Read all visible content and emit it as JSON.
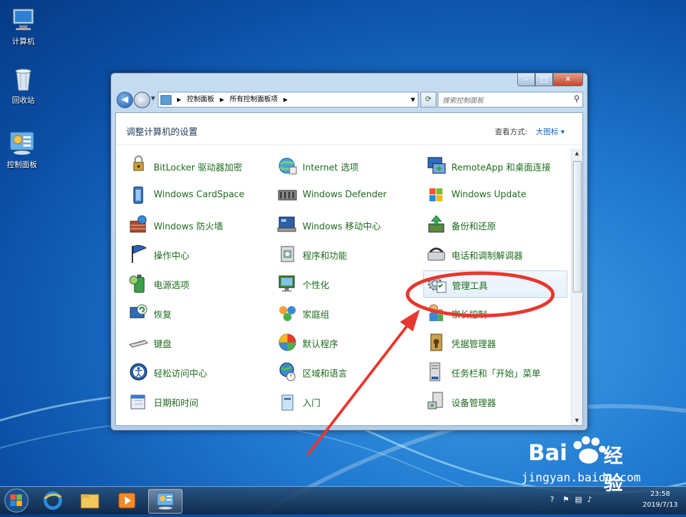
{
  "desktop": {
    "icons": [
      {
        "label": "计算机"
      },
      {
        "label": "回收站"
      },
      {
        "label": "控制面板"
      }
    ]
  },
  "window": {
    "buttons": {
      "minimize": "–",
      "maximize": "□",
      "close": "✕"
    },
    "breadcrumb": [
      "控制面板",
      "所有控制面板项"
    ],
    "search_placeholder": "搜索控制面板",
    "heading": "调整计算机的设置",
    "view_by_label": "查看方式:",
    "view_by_value": "大图标 ▾",
    "items": [
      {
        "label": "BitLocker 驱动器加密",
        "icon": "bitlocker-icon"
      },
      {
        "label": "Internet 选项",
        "icon": "internet-options-icon"
      },
      {
        "label": "RemoteApp 和桌面连接",
        "icon": "remoteapp-icon"
      },
      {
        "label": "Windows CardSpace",
        "icon": "cardspace-icon"
      },
      {
        "label": "Windows Defender",
        "icon": "defender-icon"
      },
      {
        "label": "Windows Update",
        "icon": "windows-update-icon"
      },
      {
        "label": "Windows 防火墙",
        "icon": "firewall-icon"
      },
      {
        "label": "Windows 移动中心",
        "icon": "mobility-center-icon"
      },
      {
        "label": "备份和还原",
        "icon": "backup-restore-icon"
      },
      {
        "label": "操作中心",
        "icon": "action-center-flag-icon"
      },
      {
        "label": "程序和功能",
        "icon": "programs-features-icon"
      },
      {
        "label": "电话和调制解调器",
        "icon": "phone-modem-icon"
      },
      {
        "label": "电源选项",
        "icon": "power-options-icon"
      },
      {
        "label": "个性化",
        "icon": "personalization-icon"
      },
      {
        "label": "管理工具",
        "icon": "admin-tools-icon"
      },
      {
        "label": "恢复",
        "icon": "recovery-icon"
      },
      {
        "label": "家庭组",
        "icon": "homegroup-icon"
      },
      {
        "label": "家长控制",
        "icon": "parental-controls-icon"
      },
      {
        "label": "键盘",
        "icon": "keyboard-icon"
      },
      {
        "label": "默认程序",
        "icon": "default-programs-icon"
      },
      {
        "label": "凭据管理器",
        "icon": "credential-manager-icon"
      },
      {
        "label": "轻松访问中心",
        "icon": "ease-of-access-icon"
      },
      {
        "label": "区域和语言",
        "icon": "region-language-icon"
      },
      {
        "label": "任务栏和「开始」菜单",
        "icon": "taskbar-start-icon"
      },
      {
        "label": "日期和时间",
        "icon": "date-time-icon"
      },
      {
        "label": "入门",
        "icon": "getting-started-icon"
      },
      {
        "label": "设备管理器",
        "icon": "device-manager-icon"
      }
    ]
  },
  "taskbar": {
    "apps": [
      "internet-explorer-icon",
      "file-explorer-icon",
      "media-player-icon",
      "control-panel-icon"
    ],
    "time": "23:58",
    "date": "2019/7/13"
  },
  "watermark": {
    "brand": "Bai",
    "brand_suffix": "经验",
    "url": "jingyan.baidu.com"
  },
  "colors": {
    "link_green": "#1d6b1d",
    "annotation_red": "#e8372e"
  }
}
